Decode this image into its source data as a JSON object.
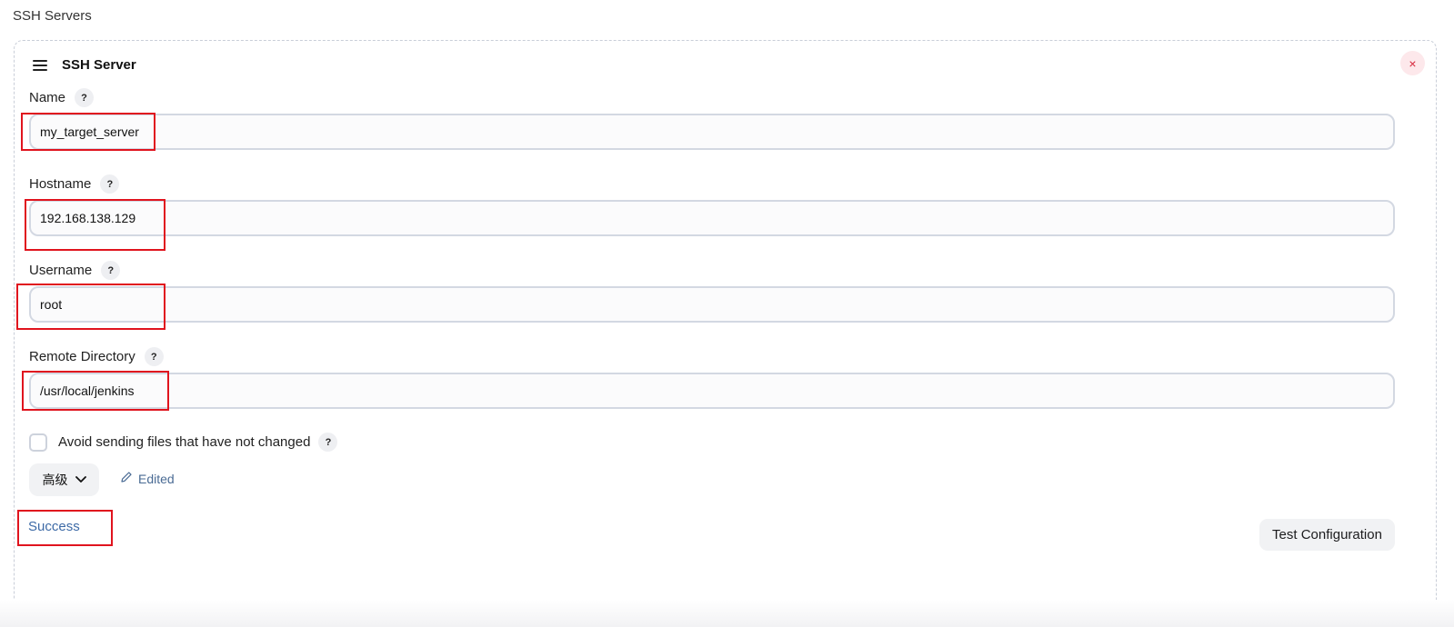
{
  "section": {
    "title": "SSH Servers"
  },
  "server": {
    "title": "SSH Server",
    "close_label": "×",
    "help_label": "?",
    "fields": {
      "name": {
        "label": "Name",
        "value": "my_target_server"
      },
      "hostname": {
        "label": "Hostname",
        "value": "192.168.138.129"
      },
      "username": {
        "label": "Username",
        "value": "root"
      },
      "remote_directory": {
        "label": "Remote Directory",
        "value": "/usr/local/jenkins"
      }
    },
    "avoid_unchanged": {
      "label": "Avoid sending files that have not changed",
      "checked": false
    },
    "advanced_label": "高级",
    "edited_label": "Edited",
    "status_text": "Success",
    "test_button_label": "Test Configuration"
  },
  "colors": {
    "highlight_box": "#e0141e",
    "link": "#3d6aa6",
    "close_icon": "#d6253a"
  }
}
